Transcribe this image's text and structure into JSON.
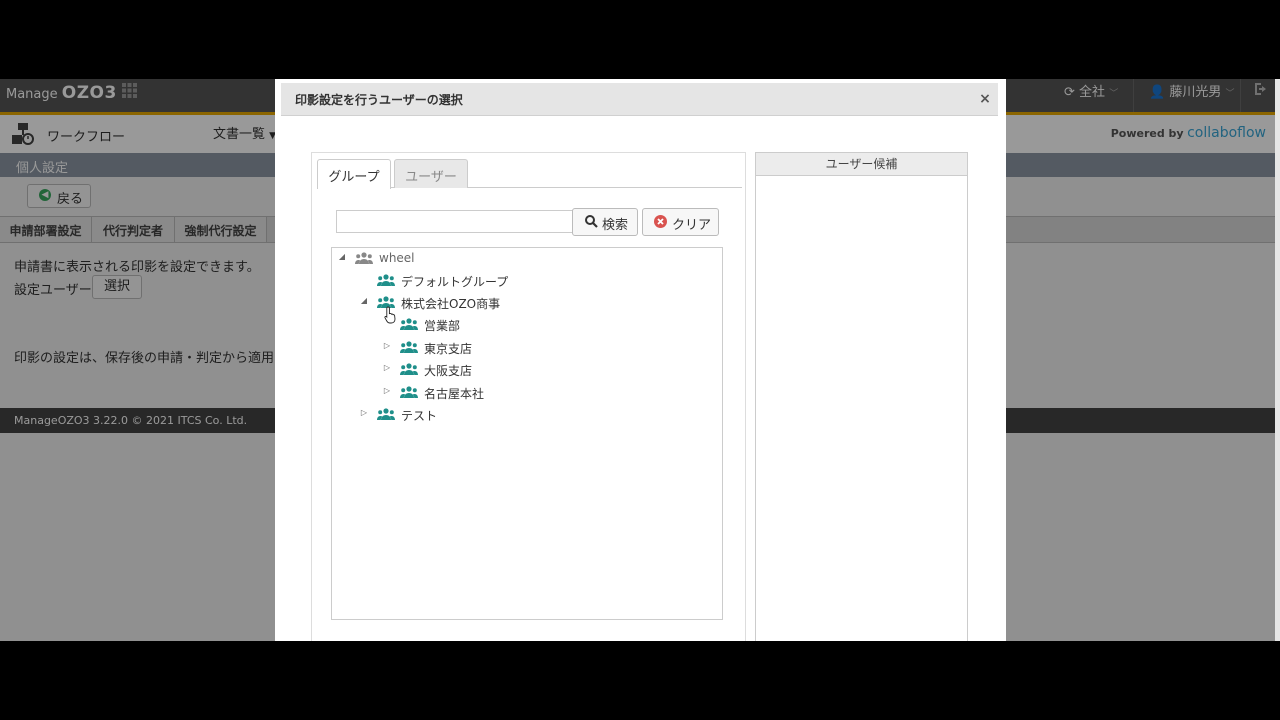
{
  "app": {
    "logo_prefix": "Manage",
    "logo_main": "OZO3",
    "scope_label": "全社",
    "user_name": "藤川光男",
    "nav": {
      "workflow_label": "ワークフロー",
      "doc_menu_label": "文書一覧"
    },
    "powered_prefix": "Powered by",
    "powered_brand": "collaboflow",
    "section_title": "個人設定",
    "back_label": "戻る",
    "settings_tabs": [
      "申請部署設定",
      "代行判定者",
      "強制代行設定"
    ],
    "description": "申請書に表示される印影を設定できます。",
    "setting_user_label": "設定ユーザー",
    "select_label": "選択",
    "note": "印影の設定は、保存後の申請・判定から適用",
    "footer": "ManageOZO3 3.22.0 © 2021 ITCS Co. Ltd."
  },
  "modal": {
    "title": "印影設定を行うユーザーの選択",
    "tabs": [
      {
        "label": "グループ",
        "active": true
      },
      {
        "label": "ユーザー",
        "active": false
      }
    ],
    "search": {
      "value": "",
      "search_label": "検索",
      "clear_label": "クリア"
    },
    "tree": [
      {
        "label": "wheel",
        "toggle": "expanded",
        "icon": "group-gray-icon",
        "depth": 0
      },
      {
        "label": "デフォルトグループ",
        "toggle": "none",
        "icon": "group-teal-icon",
        "depth": 1
      },
      {
        "label": "株式会社OZO商事",
        "toggle": "expanded",
        "icon": "group-teal-icon",
        "depth": 1
      },
      {
        "label": "営業部",
        "toggle": "none",
        "icon": "group-teal-icon",
        "depth": 2
      },
      {
        "label": "東京支店",
        "toggle": "collapsed",
        "icon": "group-teal-icon",
        "depth": 2
      },
      {
        "label": "大阪支店",
        "toggle": "collapsed",
        "icon": "group-teal-icon",
        "depth": 2
      },
      {
        "label": "名古屋本社",
        "toggle": "collapsed",
        "icon": "group-teal-icon",
        "depth": 2
      },
      {
        "label": "テスト",
        "toggle": "collapsed",
        "icon": "group-teal-icon",
        "depth": 1
      }
    ],
    "candidates_title": "ユーザー候補",
    "candidates": []
  },
  "colors": {
    "accent": "#e8a800",
    "teal": "#1f8f8a",
    "topbar": "#555555",
    "section": "#8c97a3"
  }
}
